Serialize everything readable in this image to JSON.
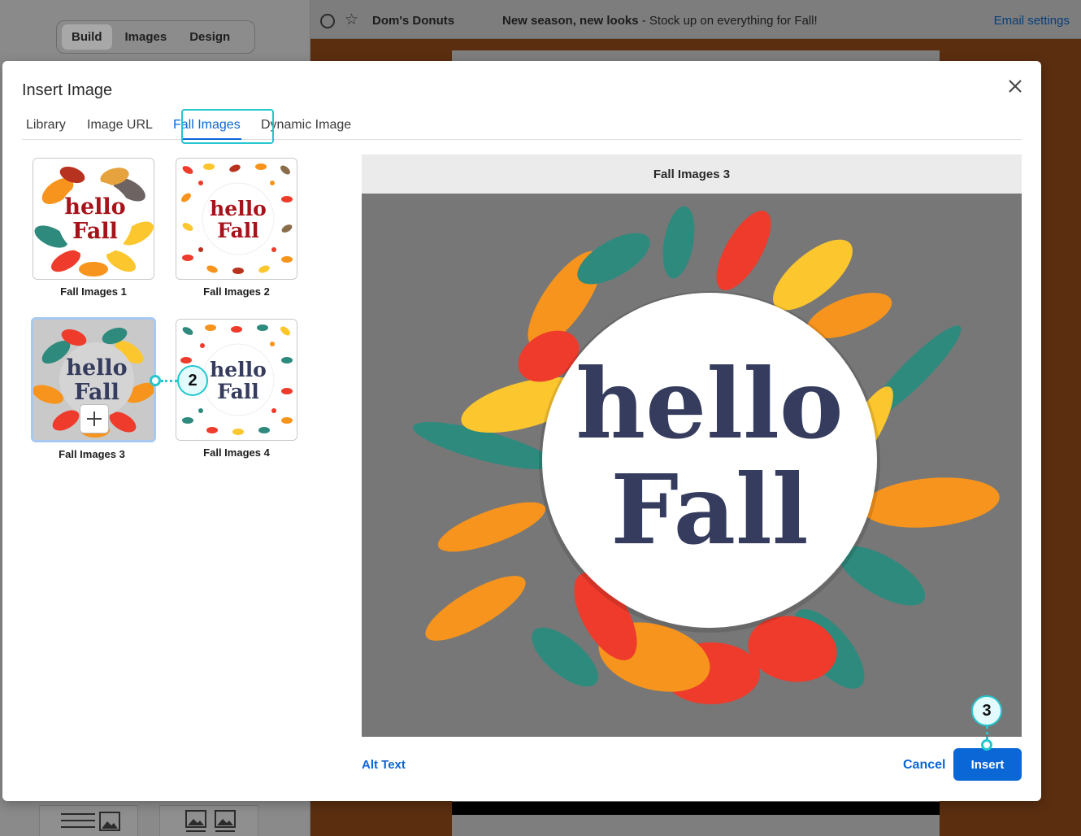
{
  "app": {
    "tabs": [
      "Build",
      "Images",
      "Design"
    ],
    "active_tab": "Build",
    "header": {
      "from": "Dom's Donuts",
      "subject_bold": "New season, new looks",
      "subject_rest": " - Stock up on everything for Fall!",
      "email_settings": "Email settings"
    }
  },
  "modal": {
    "title": "Insert Image",
    "tabs": [
      {
        "label": "Library"
      },
      {
        "label": "Image URL"
      },
      {
        "label": "Fall Images"
      },
      {
        "label": "Dynamic Image"
      }
    ],
    "active_tab": "Fall Images",
    "thumbnails": [
      {
        "label": "Fall Images 1",
        "art_text": [
          "hello",
          "Fall"
        ],
        "text_color": "#a6131a"
      },
      {
        "label": "Fall Images 2",
        "art_text": [
          "hello",
          "Fall"
        ],
        "text_color": "#a6131a"
      },
      {
        "label": "Fall Images 3",
        "art_text": [
          "hello",
          "Fall"
        ],
        "text_color": "#353c5e"
      },
      {
        "label": "Fall Images 4",
        "art_text": [
          "hello",
          "Fall"
        ],
        "text_color": "#353c5e"
      }
    ],
    "selected_thumbnail": "Fall Images 3",
    "preview": {
      "title": "Fall Images 3",
      "art_text": [
        "hello",
        "Fall"
      ]
    },
    "alt_text_label": "Alt Text",
    "cancel_label": "Cancel",
    "insert_label": "Insert"
  },
  "callouts": [
    {
      "number": "2"
    },
    {
      "number": "3"
    }
  ],
  "colors": {
    "accent": "#0b66d6",
    "callout": "#25c6cf",
    "leaf_orange": "#f7941d",
    "leaf_red": "#ee3b2c",
    "leaf_yellow": "#fcc62f",
    "leaf_teal": "#2f8a7e",
    "text_navy": "#353c5e"
  }
}
